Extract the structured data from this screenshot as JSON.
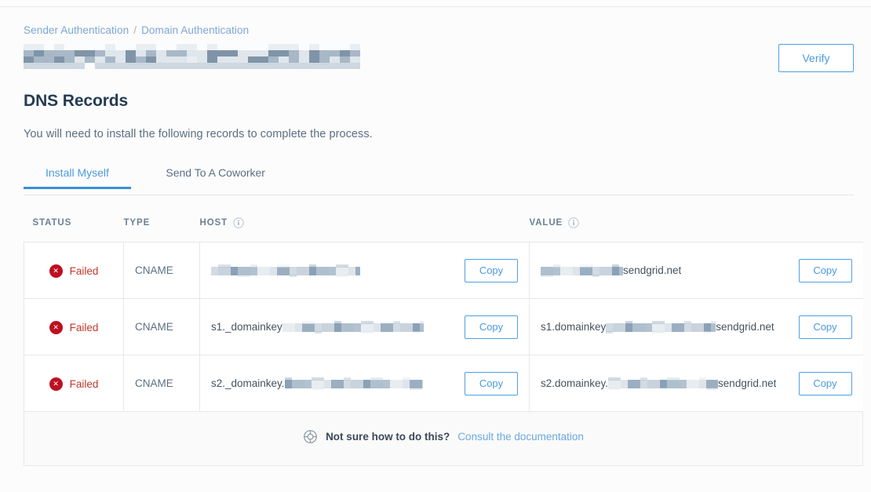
{
  "breadcrumb": {
    "items": [
      {
        "label": "Sender Authentication"
      },
      {
        "label": "Domain Authentication"
      }
    ],
    "separator": "/"
  },
  "header": {
    "domain_title_redacted": "",
    "verify_label": "Verify"
  },
  "main": {
    "title": "DNS Records",
    "subtitle": "You will need to install the following records to complete the process.",
    "tabs": [
      {
        "label": "Install Myself",
        "active": true
      },
      {
        "label": "Send To A Coworker",
        "active": false
      }
    ]
  },
  "table": {
    "columns": {
      "status": "STATUS",
      "type": "TYPE",
      "host": "HOST",
      "value": "VALUE",
      "host_info_icon": "info-icon",
      "value_info_icon": "info-icon"
    },
    "copy_label": "Copy",
    "rows": [
      {
        "status": "Failed",
        "status_icon": "error-circle-icon",
        "type": "CNAME",
        "host_prefix": "",
        "host_redacted": true,
        "host_suffix": "",
        "value_prefix": "",
        "value_redacted": true,
        "value_suffix": "sendgrid.net",
        "copy_host_label": "Copy",
        "copy_value_label": "Copy"
      },
      {
        "status": "Failed",
        "status_icon": "error-circle-icon",
        "type": "CNAME",
        "host_prefix": "s1._domainkey",
        "host_redacted": true,
        "host_suffix": "",
        "value_prefix": "s1.domainkey",
        "value_redacted": true,
        "value_suffix": "sendgrid.net",
        "copy_host_label": "Copy",
        "copy_value_label": "Copy"
      },
      {
        "status": "Failed",
        "status_icon": "error-circle-icon",
        "type": "CNAME",
        "host_prefix": "s2._domainkey.",
        "host_redacted": true,
        "host_suffix": "",
        "value_prefix": "s2.domainkey.",
        "value_redacted": true,
        "value_suffix": "sendgrid.net",
        "copy_host_label": "Copy",
        "copy_value_label": "Copy"
      }
    ]
  },
  "footer": {
    "icon": "lifebuoy-icon",
    "question": "Not sure how to do this?",
    "link_label": "Consult the documentation"
  },
  "colors": {
    "accent_blue": "#4a9ae0",
    "tab_underline": "#3a8fd8",
    "error_red": "#bd1021",
    "error_text": "#c0392b",
    "heading": "#243b53",
    "body_text": "#5c6f82",
    "border": "#e6e8ea",
    "footer_bg": "#fafafa",
    "page_bg": "#fcfcfd"
  }
}
